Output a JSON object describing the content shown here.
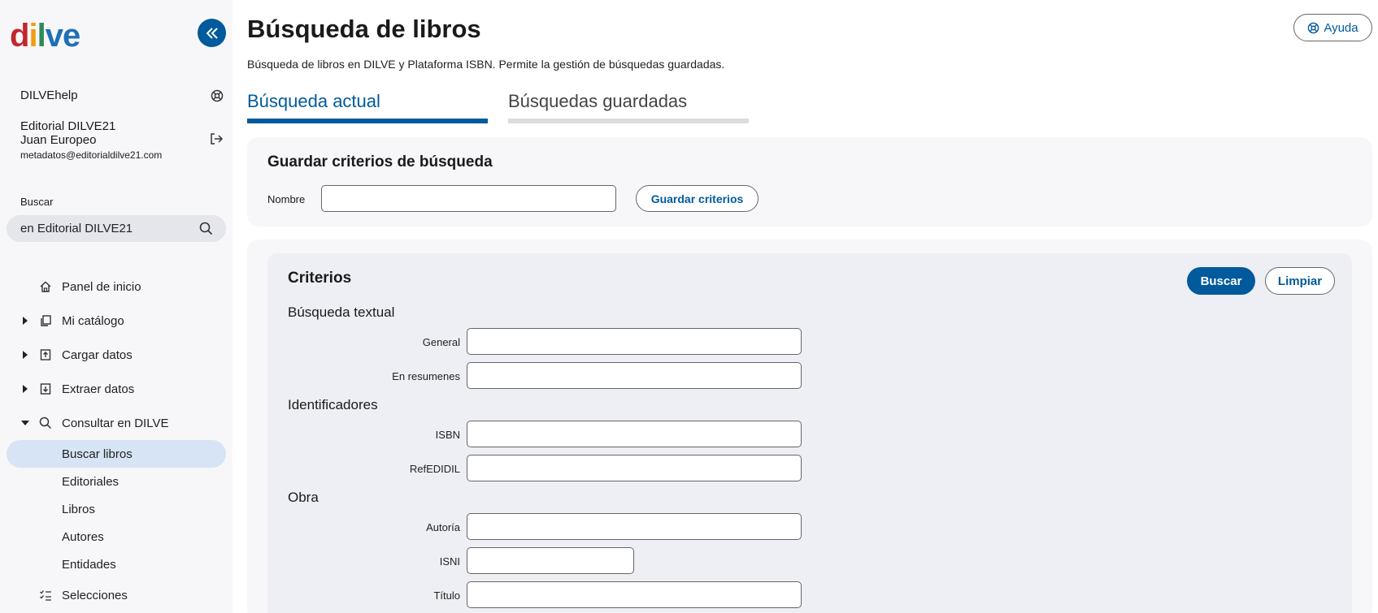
{
  "sidebar": {
    "logo": {
      "d": "d",
      "i": "i",
      "l": "l",
      "v": "v",
      "e": "e"
    },
    "help_label": "DILVEhelp",
    "org": "Editorial DILVE21",
    "user_name": "Juan Europeo",
    "email": "metadatos@editorialdilve21.com",
    "search_label": "Buscar",
    "search_value": "en Editorial DILVE21",
    "nav": [
      {
        "label": "Panel de inicio"
      },
      {
        "label": "Mi catálogo"
      },
      {
        "label": "Cargar datos"
      },
      {
        "label": "Extraer datos"
      },
      {
        "label": "Consultar en DILVE"
      }
    ],
    "sub": [
      {
        "label": "Buscar libros"
      },
      {
        "label": "Editoriales"
      },
      {
        "label": "Libros"
      },
      {
        "label": "Autores"
      },
      {
        "label": "Entidades"
      }
    ],
    "selecciones": "Selecciones"
  },
  "main": {
    "title": "Búsqueda de libros",
    "description": "Búsqueda de libros en DILVE y Plataforma ISBN. Permite la gestión de búsquedas guardadas.",
    "help_button": "Ayuda",
    "tabs": [
      {
        "label": "Búsqueda actual"
      },
      {
        "label": "Búsquedas guardadas"
      }
    ],
    "save": {
      "title": "Guardar criterios de búsqueda",
      "name_label": "Nombre",
      "button": "Guardar criterios"
    },
    "criteria": {
      "title": "Criterios",
      "search_button": "Buscar",
      "clear_button": "Limpiar",
      "sections": {
        "textual": "Búsqueda textual",
        "identificadores": "Identificadores",
        "obra": "Obra"
      },
      "fields": {
        "general": "General",
        "resumenes": "En resumenes",
        "isbn": "ISBN",
        "refedidil": "RefEDIDIL",
        "autoria": "Autoría",
        "isni": "ISNI",
        "titulo": "Título"
      }
    }
  },
  "colors": {
    "primary": "#005a9c",
    "active_bg": "#d6e4f5",
    "panel_bg": "#f7f7f9"
  }
}
